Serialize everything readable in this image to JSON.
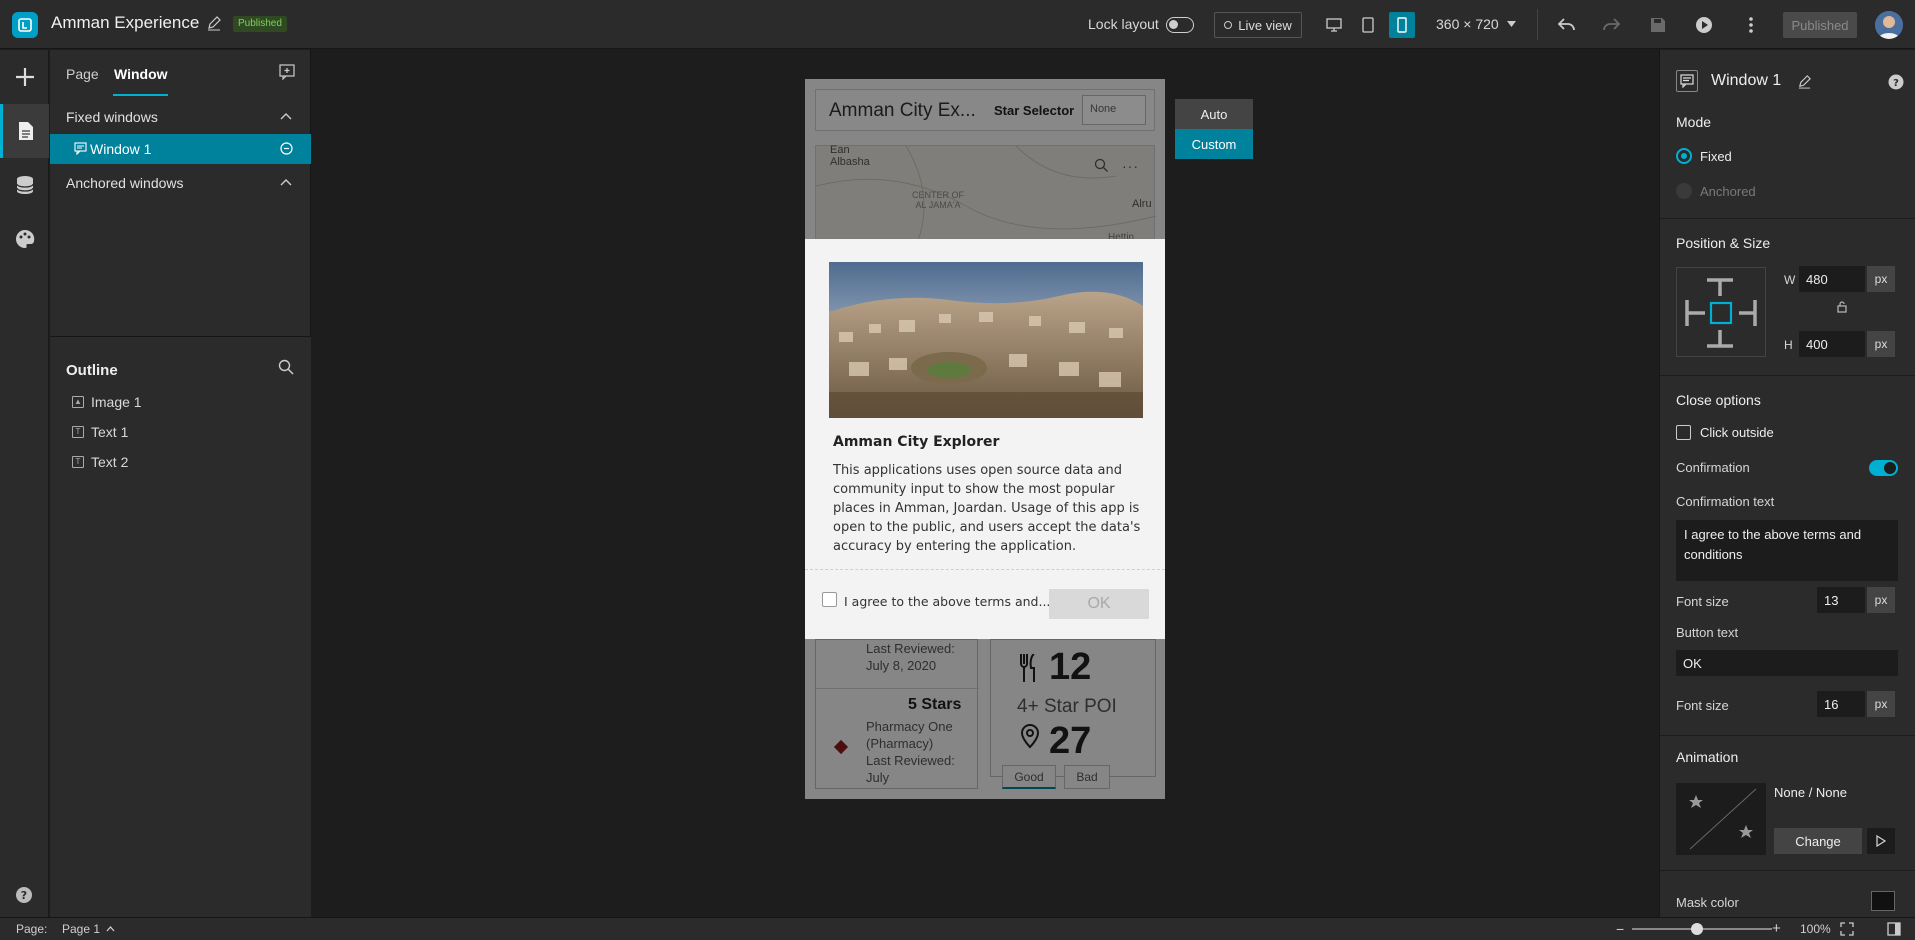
{
  "header": {
    "app_title": "Amman Experience",
    "status_badge": "Published",
    "lock_layout_label": "Lock layout",
    "live_view_label": "Live view",
    "screen_size": "360 × 720",
    "publish_button": "Published"
  },
  "left_panel": {
    "tabs": [
      "Page",
      "Window"
    ],
    "active_tab": "Window",
    "fixed_windows_label": "Fixed windows",
    "window_item": "Window 1",
    "anchored_windows_label": "Anchored windows",
    "outline_title": "Outline",
    "outline_items": [
      "Image 1",
      "Text 1",
      "Text 2"
    ]
  },
  "canvas": {
    "app_header_title": "Amman City Ex...",
    "star_selector_label": "Star Selector",
    "star_selector_value": "None",
    "map_labels": [
      "Ean Albasha",
      "CENTER OF AL JAMA'A",
      "Alru",
      "Hettin"
    ],
    "list_items": [
      {
        "text": "Last Reviewed: July 8, 2020"
      },
      {
        "stars": "5 Stars",
        "name": "Pharmacy One (Pharmacy)",
        "reviewed": "Last Reviewed: July"
      }
    ],
    "stat_1": "12",
    "stat_label": "4+ Star POI",
    "stat_2": "27",
    "tab_good": "Good",
    "tab_bad": "Bad",
    "mode_buttons": [
      "Auto",
      "Custom"
    ],
    "modal": {
      "title": "Amman City Explorer",
      "body": "This applications uses open source data and community input to show the most popular places in Amman, Joardan. Usage of this app is open to the public, and users accept the data's accuracy by entering the application.",
      "agree_text": "I agree to the above terms and...",
      "ok_label": "OK"
    }
  },
  "right_panel": {
    "title": "Window 1",
    "mode_label": "Mode",
    "mode_fixed": "Fixed",
    "mode_anchored": "Anchored",
    "position_size_label": "Position & Size",
    "w_label": "W",
    "w_value": "480",
    "h_label": "H",
    "h_value": "400",
    "unit": "px",
    "close_options_label": "Close options",
    "click_outside_label": "Click outside",
    "confirmation_label": "Confirmation",
    "confirmation_text_label": "Confirmation text",
    "confirmation_text_value": "I agree to the above terms and conditions",
    "font_size_label": "Font size",
    "font_size_1": "13",
    "button_text_label": "Button text",
    "button_text_value": "OK",
    "font_size_2": "16",
    "animation_label": "Animation",
    "animation_value": "None / None",
    "change_button": "Change",
    "mask_color_label": "Mask color"
  },
  "statusbar": {
    "page_label": "Page:",
    "page_value": "Page 1",
    "zoom": "100%"
  },
  "colors": {
    "accent": "#00819c",
    "accent_light": "#00b0d3",
    "panel_bg": "#2b2b2b",
    "canvas_bg": "#1d1d1d"
  }
}
